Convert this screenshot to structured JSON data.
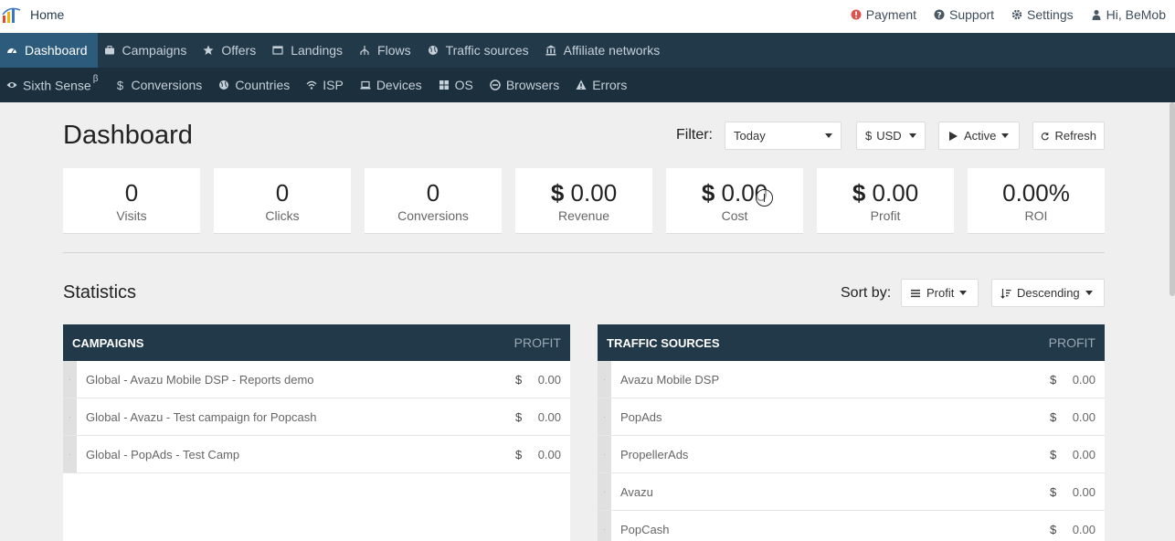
{
  "header": {
    "home_label": "Home",
    "links": [
      {
        "label": "Payment",
        "icon": "alert-icon",
        "color": "#d9534f"
      },
      {
        "label": "Support",
        "icon": "question-icon"
      },
      {
        "label": "Settings",
        "icon": "gear-icon"
      },
      {
        "label": "Hi, BeMob",
        "icon": "user-icon"
      }
    ]
  },
  "nav_primary": [
    {
      "label": "Dashboard",
      "icon": "dashboard-icon",
      "active": true
    },
    {
      "label": "Campaigns",
      "icon": "briefcase-icon"
    },
    {
      "label": "Offers",
      "icon": "star-icon"
    },
    {
      "label": "Landings",
      "icon": "window-icon"
    },
    {
      "label": "Flows",
      "icon": "flow-icon"
    },
    {
      "label": "Traffic sources",
      "icon": "globe-icon"
    },
    {
      "label": "Affiliate networks",
      "icon": "bank-icon"
    }
  ],
  "nav_secondary": [
    {
      "label": "Sixth Sense",
      "sup": "β",
      "icon": "eye-icon"
    },
    {
      "label": "Conversions",
      "icon": "dollar-icon"
    },
    {
      "label": "Countries",
      "icon": "globe-icon"
    },
    {
      "label": "ISP",
      "icon": "wifi-icon"
    },
    {
      "label": "Devices",
      "icon": "laptop-icon"
    },
    {
      "label": "OS",
      "icon": "windows-icon"
    },
    {
      "label": "Browsers",
      "icon": "browser-icon"
    },
    {
      "label": "Errors",
      "icon": "warning-icon"
    }
  ],
  "page": {
    "title": "Dashboard",
    "filter_label": "Filter:",
    "filter_value": "Today",
    "currency": "USD",
    "currency_symbol": "$",
    "status": "Active",
    "refresh_label": "Refresh"
  },
  "metrics": [
    {
      "value": "0",
      "label": "Visits"
    },
    {
      "value": "0",
      "label": "Clicks"
    },
    {
      "value": "0",
      "label": "Conversions"
    },
    {
      "currency": "$",
      "value": "0.00",
      "label": "Revenue"
    },
    {
      "currency": "$",
      "value": "0.00",
      "label": "Cost"
    },
    {
      "currency": "$",
      "value": "0.00",
      "label": "Profit"
    },
    {
      "value": "0.00%",
      "label": "ROI"
    }
  ],
  "statistics": {
    "title": "Statistics",
    "sort_label": "Sort by:",
    "sort_field": "Profit",
    "sort_order": "Descending",
    "campaigns": {
      "header": "CAMPAIGNS",
      "col": "PROFIT",
      "rows": [
        {
          "name": "Global - Avazu Mobile DSP - Reports demo",
          "currency": "$",
          "amount": "0.00"
        },
        {
          "name": "Global - Avazu - Test campaign for Popcash",
          "currency": "$",
          "amount": "0.00"
        },
        {
          "name": "Global - PopAds - Test Camp",
          "currency": "$",
          "amount": "0.00"
        }
      ]
    },
    "traffic_sources": {
      "header": "TRAFFIC SOURCES",
      "col": "PROFIT",
      "rows": [
        {
          "name": "Avazu Mobile DSP",
          "currency": "$",
          "amount": "0.00"
        },
        {
          "name": "PopAds",
          "currency": "$",
          "amount": "0.00"
        },
        {
          "name": "PropellerAds",
          "currency": "$",
          "amount": "0.00"
        },
        {
          "name": "Avazu",
          "currency": "$",
          "amount": "0.00"
        },
        {
          "name": "PopCash",
          "currency": "$",
          "amount": "0.00"
        }
      ]
    }
  }
}
